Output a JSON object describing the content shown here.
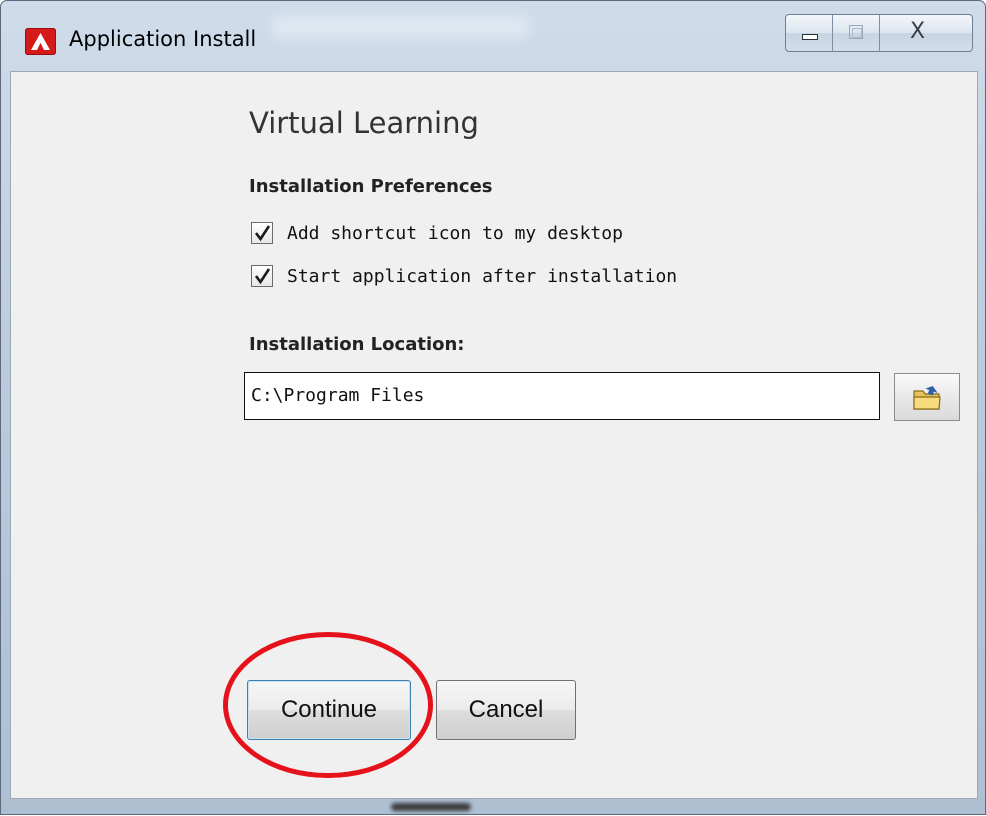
{
  "window": {
    "title": "Application Install",
    "close_symbol": "X"
  },
  "content": {
    "app_name": "Virtual Learning",
    "preferences_heading": "Installation Preferences",
    "options": [
      {
        "label": "Add shortcut icon to my desktop",
        "checked": true
      },
      {
        "label": "Start application after installation",
        "checked": true
      }
    ],
    "location_heading": "Installation Location:",
    "location_value": "C:\\Program Files"
  },
  "buttons": {
    "continue": "Continue",
    "cancel": "Cancel"
  },
  "icons": {
    "app": "adobe-air-icon",
    "browse": "folder-icon",
    "minimize": "minimize-icon",
    "maximize": "maximize-icon",
    "close": "close-icon",
    "checkmark": "checkmark-icon"
  },
  "colors": {
    "highlight": "#e6121b",
    "app_icon": "#d61a1a",
    "focus_border": "#3c7fb1"
  }
}
